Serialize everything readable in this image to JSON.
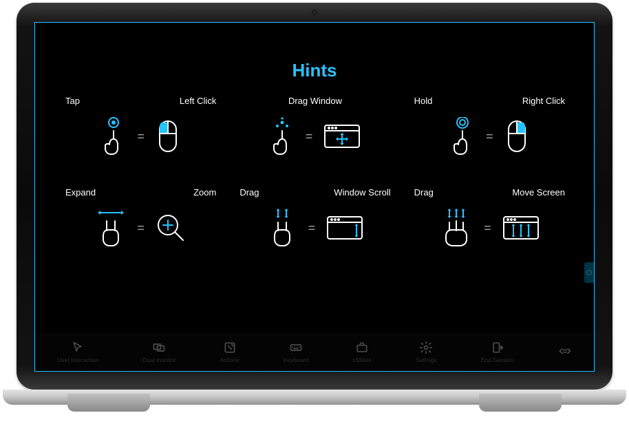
{
  "title": "Hints",
  "grid": [
    {
      "left": "Tap",
      "right": "Left Click",
      "pair": "tap-leftclick"
    },
    {
      "left": "",
      "right": "Drag Window",
      "pair": "drag-window",
      "center": true
    },
    {
      "left": "Hold",
      "right": "Right Click",
      "pair": "hold-rightclick"
    },
    {
      "left": "Expand",
      "right": "Zoom",
      "pair": "expand-zoom"
    },
    {
      "left": "Drag",
      "right": "Window Scroll",
      "pair": "drag-windowscroll"
    },
    {
      "left": "Drag",
      "right": "Move Screen",
      "pair": "drag-movescreen"
    }
  ],
  "eq": "=",
  "toolbar": [
    {
      "id": "user-interaction",
      "label": "User Interaction"
    },
    {
      "id": "dual-monitor",
      "label": "Dual monitor"
    },
    {
      "id": "actions",
      "label": "Actions"
    },
    {
      "id": "keyboard",
      "label": "Keyboard"
    },
    {
      "id": "utilities",
      "label": "Utilities"
    },
    {
      "id": "settings",
      "label": "Settings"
    },
    {
      "id": "end-session",
      "label": "End Session"
    },
    {
      "id": "expand",
      "label": ""
    }
  ]
}
